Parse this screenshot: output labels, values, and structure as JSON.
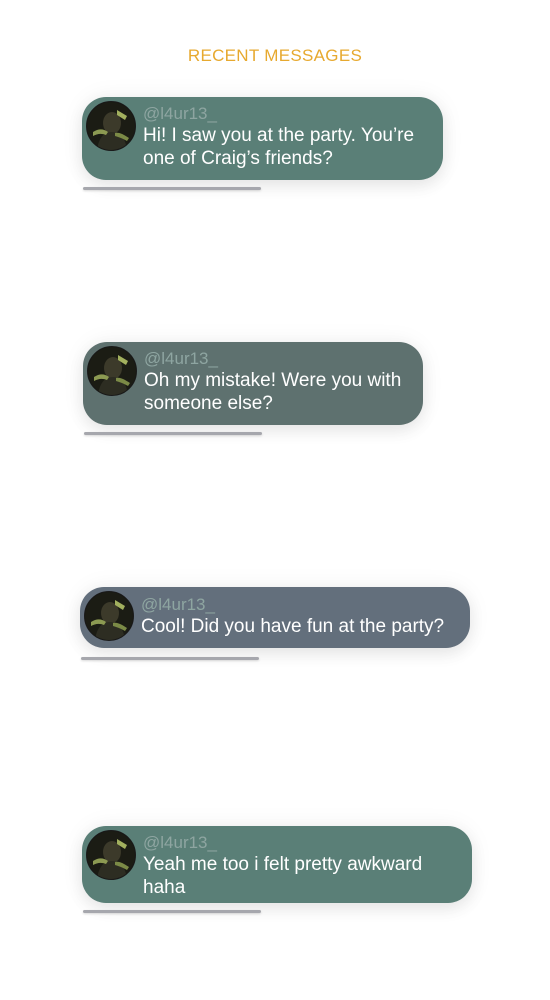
{
  "header": {
    "title": "RECENT MESSAGES"
  },
  "colors": {
    "title": "#e7a92f",
    "handle": "#8ea5a1",
    "underline": "#a6a7ad",
    "bubble_green": "#5a7f77",
    "bubble_slate": "#5e716f",
    "bubble_blue_gray": "#636f7c"
  },
  "messages": [
    {
      "handle": "@l4ur13_",
      "text": "Hi! I saw you at the party. You’re one of Craig’s friends?",
      "bubble_color": "#5a7f77",
      "avatar_icon": "person-photo-icon"
    },
    {
      "handle": "@l4ur13_",
      "text": "Oh my mistake! Were you with someone else?",
      "bubble_color": "#5e716f",
      "avatar_icon": "person-photo-icon"
    },
    {
      "handle": "@l4ur13_",
      "text": "Cool! Did you have fun at the party?",
      "bubble_color": "#636f7c",
      "avatar_icon": "person-photo-icon"
    },
    {
      "handle": "@l4ur13_",
      "text": "Yeah me too i felt pretty awkward haha",
      "bubble_color": "#5a7f77",
      "avatar_icon": "person-photo-icon"
    }
  ]
}
